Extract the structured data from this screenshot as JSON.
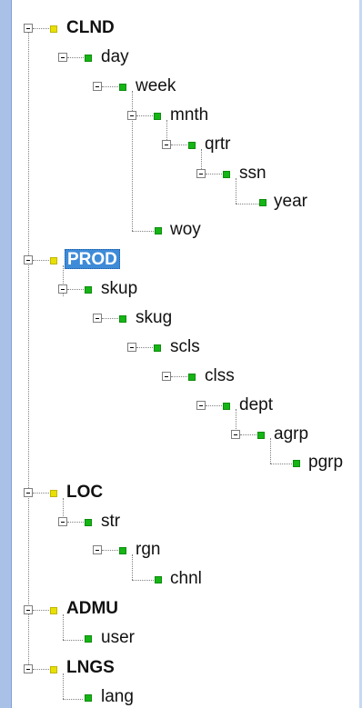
{
  "tree": {
    "nodes": [
      {
        "label": "CLND",
        "kind": "root",
        "icon": "yellow-node-icon"
      },
      {
        "label": "day",
        "kind": "level",
        "icon": "green-node-icon"
      },
      {
        "label": "week",
        "kind": "level",
        "icon": "green-node-icon"
      },
      {
        "label": "mnth",
        "kind": "level",
        "icon": "green-node-icon"
      },
      {
        "label": "qrtr",
        "kind": "level",
        "icon": "green-node-icon"
      },
      {
        "label": "ssn",
        "kind": "level",
        "icon": "green-node-icon"
      },
      {
        "label": "year",
        "kind": "level",
        "icon": "green-node-icon"
      },
      {
        "label": "woy",
        "kind": "level",
        "icon": "green-node-icon"
      },
      {
        "label": "PROD",
        "kind": "root",
        "selected": true,
        "icon": "yellow-node-icon"
      },
      {
        "label": "skup",
        "kind": "level",
        "icon": "green-node-icon"
      },
      {
        "label": "skug",
        "kind": "level",
        "icon": "green-node-icon"
      },
      {
        "label": "scls",
        "kind": "level",
        "icon": "green-node-icon"
      },
      {
        "label": "clss",
        "kind": "level",
        "icon": "green-node-icon"
      },
      {
        "label": "dept",
        "kind": "level",
        "icon": "green-node-icon"
      },
      {
        "label": "agrp",
        "kind": "level",
        "icon": "green-node-icon"
      },
      {
        "label": "pgrp",
        "kind": "level",
        "icon": "green-node-icon"
      },
      {
        "label": "LOC",
        "kind": "root",
        "icon": "yellow-node-icon"
      },
      {
        "label": "str",
        "kind": "level",
        "icon": "green-node-icon"
      },
      {
        "label": "rgn",
        "kind": "level",
        "icon": "green-node-icon"
      },
      {
        "label": "chnl",
        "kind": "level",
        "icon": "green-node-icon"
      },
      {
        "label": "ADMU",
        "kind": "root",
        "icon": "yellow-node-icon"
      },
      {
        "label": "user",
        "kind": "level",
        "icon": "green-node-icon"
      },
      {
        "label": "LNGS",
        "kind": "root",
        "icon": "yellow-node-icon"
      },
      {
        "label": "lang",
        "kind": "level",
        "icon": "green-node-icon"
      }
    ]
  },
  "colors": {
    "selection": "#3e8bd8",
    "root_icon": "#e8e000",
    "level_icon": "#15b515",
    "frame": "#a9c1e6"
  }
}
